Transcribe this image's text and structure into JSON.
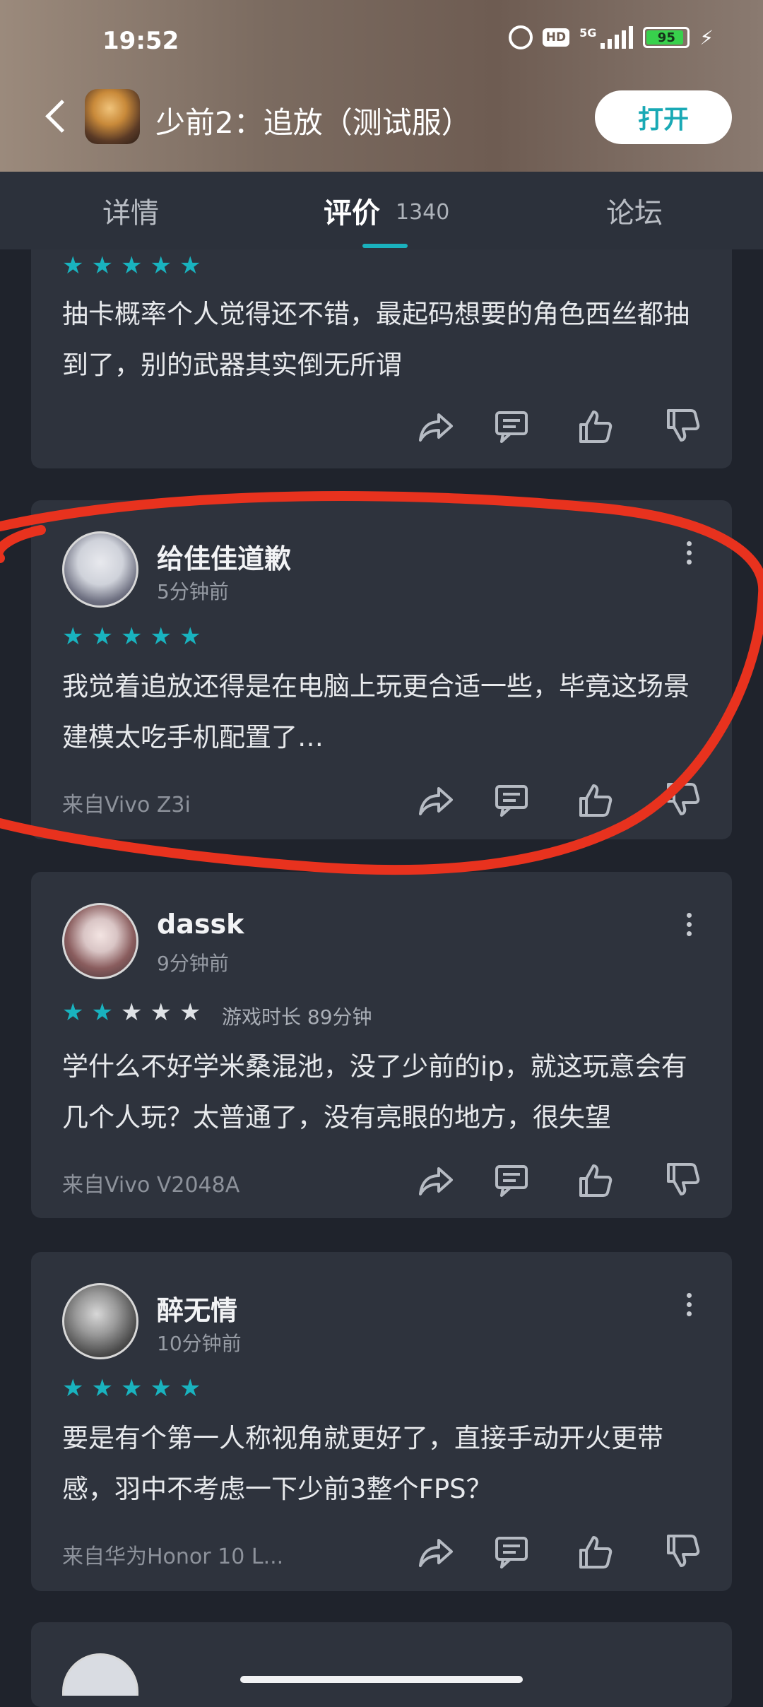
{
  "status_bar": {
    "time": "19:52",
    "hd_label": "HD",
    "network_label": "5G",
    "battery": "95"
  },
  "header": {
    "title": "少前2：追放（测试服）",
    "open_button": "打开"
  },
  "tabs": {
    "details": "详情",
    "reviews": "评价",
    "reviews_count": "1340",
    "forum": "论坛",
    "active": "reviews"
  },
  "reviews": [
    {
      "name": "",
      "time": "",
      "stars": 5,
      "text": "抽卡概率个人觉得还不错，最起码想要的角色西丝都抽到了，别的武器其实倒无所谓",
      "device": ""
    },
    {
      "name": "给佳佳道歉",
      "time": "5分钟前",
      "stars": 5,
      "text": "我觉着追放还得是在电脑上玩更合适一些，毕竟这场景建模太吃手机配置了…",
      "device": "来自Vivo Z3i"
    },
    {
      "name": "dassk",
      "time": "9分钟前",
      "stars": 2,
      "playtime": "游戏时长 89分钟",
      "text": "学什么不好学米桑混池，没了少前的ip，就这玩意会有几个人玩？太普通了，没有亮眼的地方，很失望",
      "device": "来自Vivo V2048A"
    },
    {
      "name": "醉无情",
      "time": "10分钟前",
      "stars": 5,
      "text": "要是有个第一人称视角就更好了，直接手动开火更带感，羽中不考虑一下少前3整个FPS？",
      "device": "来自华为Honor 10 L..."
    }
  ],
  "colors": {
    "accent": "#1ab1bd",
    "background": "#1f232c",
    "card": "#2e333d",
    "annotation": "#e8321e"
  },
  "icons": [
    "share-icon",
    "comment-icon",
    "thumb-up-icon",
    "thumb-down-icon",
    "more-vertical-icon",
    "back-icon"
  ]
}
